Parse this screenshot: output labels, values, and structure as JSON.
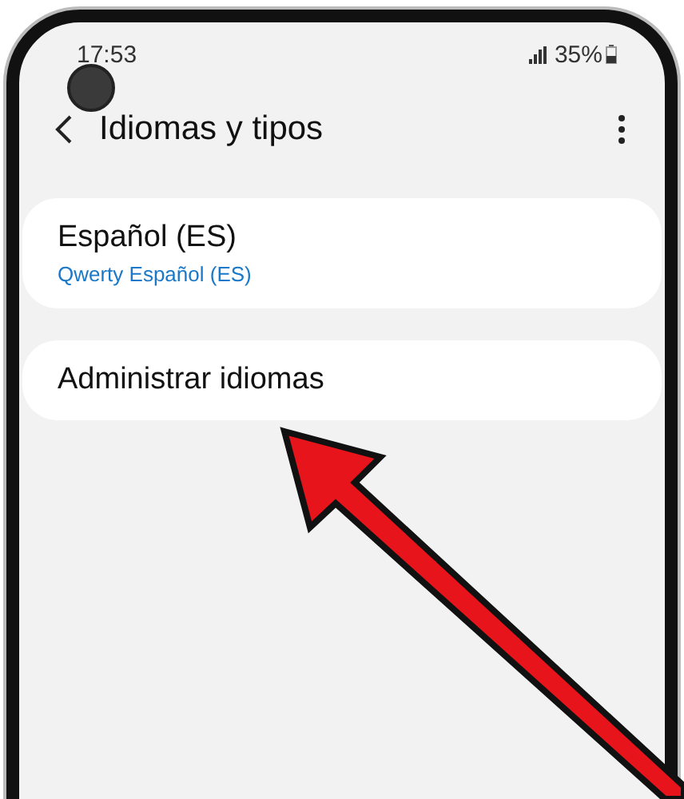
{
  "status_bar": {
    "time": "17:53",
    "battery": "35%"
  },
  "header": {
    "title": "Idiomas y tipos"
  },
  "items": [
    {
      "title": "Español (ES)",
      "subtitle": "Qwerty Español (ES)"
    },
    {
      "title": "Administrar idiomas"
    }
  ]
}
